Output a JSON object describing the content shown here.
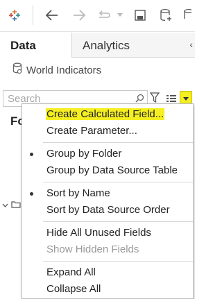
{
  "toolbar": {
    "icons": [
      "tableau-logo-icon",
      "back-arrow-icon",
      "forward-arrow-icon",
      "redo-icon",
      "dropdown-arrow-icon",
      "save-icon",
      "new-datasource-icon",
      "datasource-icon"
    ]
  },
  "tabs": [
    {
      "label": "Data",
      "active": true
    },
    {
      "label": "Analytics",
      "active": false
    }
  ],
  "collapse_symbol": "‹",
  "datasource": {
    "name": "World Indicators",
    "icon": "database-icon"
  },
  "search": {
    "placeholder": "Search",
    "value": ""
  },
  "background": {
    "folders_heading_fragment": "Fo"
  },
  "menu": {
    "items": [
      {
        "label": "Create Calculated Field...",
        "checked": false,
        "highlighted": true,
        "disabled": false
      },
      {
        "label": "Create Parameter...",
        "checked": false,
        "highlighted": false,
        "disabled": false
      },
      {
        "label": "Group by Folder",
        "checked": true,
        "highlighted": false,
        "disabled": false
      },
      {
        "label": "Group by Data Source Table",
        "checked": false,
        "highlighted": false,
        "disabled": false
      },
      {
        "label": "Sort by Name",
        "checked": true,
        "highlighted": false,
        "disabled": false
      },
      {
        "label": "Sort by Data Source Order",
        "checked": false,
        "highlighted": false,
        "disabled": false
      },
      {
        "label": "Hide All Unused Fields",
        "checked": false,
        "highlighted": false,
        "disabled": false
      },
      {
        "label": "Show Hidden Fields",
        "checked": false,
        "highlighted": false,
        "disabled": true
      },
      {
        "label": "Expand All",
        "checked": false,
        "highlighted": false,
        "disabled": false
      },
      {
        "label": "Collapse All",
        "checked": false,
        "highlighted": false,
        "disabled": false
      }
    ]
  },
  "colors": {
    "highlight": "#f5ef22",
    "accent": "#f5ef22"
  }
}
